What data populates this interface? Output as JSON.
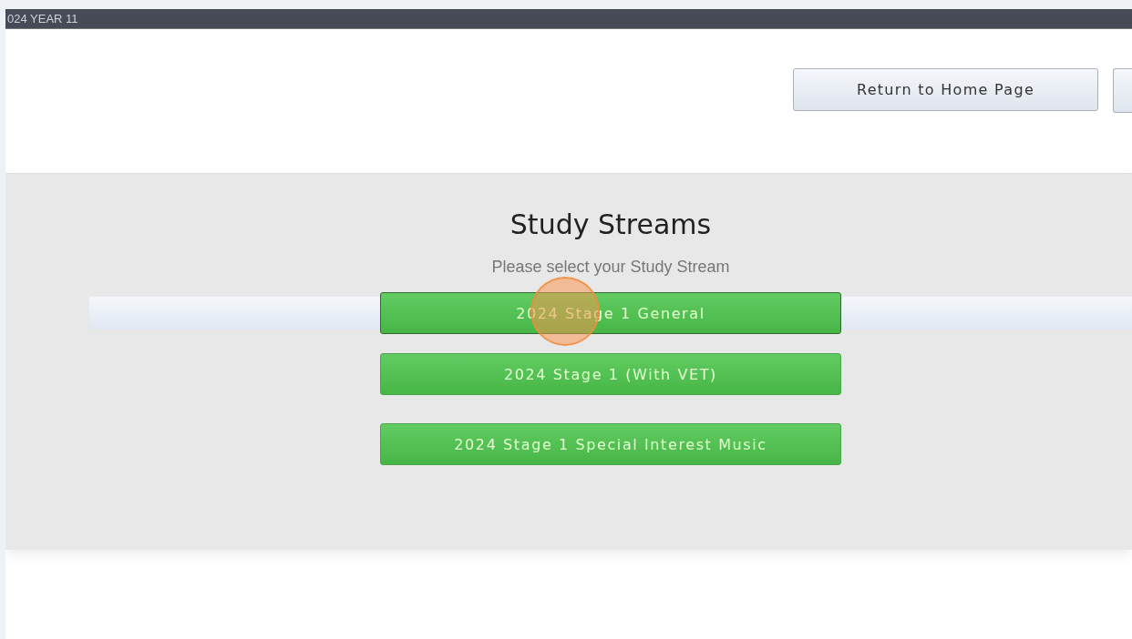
{
  "header": {
    "title": "024 YEAR 11"
  },
  "top_buttons": [
    {
      "label": "Return to Home Page"
    }
  ],
  "panel": {
    "title": "Study Streams",
    "subtitle": "Please select your Study Stream"
  },
  "streams": [
    {
      "label": "2024 Stage 1 General",
      "selected": true
    },
    {
      "label": "2024 Stage 1 (With VET)",
      "selected": false
    },
    {
      "label": "2024 Stage 1 Special Interest Music",
      "selected": false
    }
  ]
}
